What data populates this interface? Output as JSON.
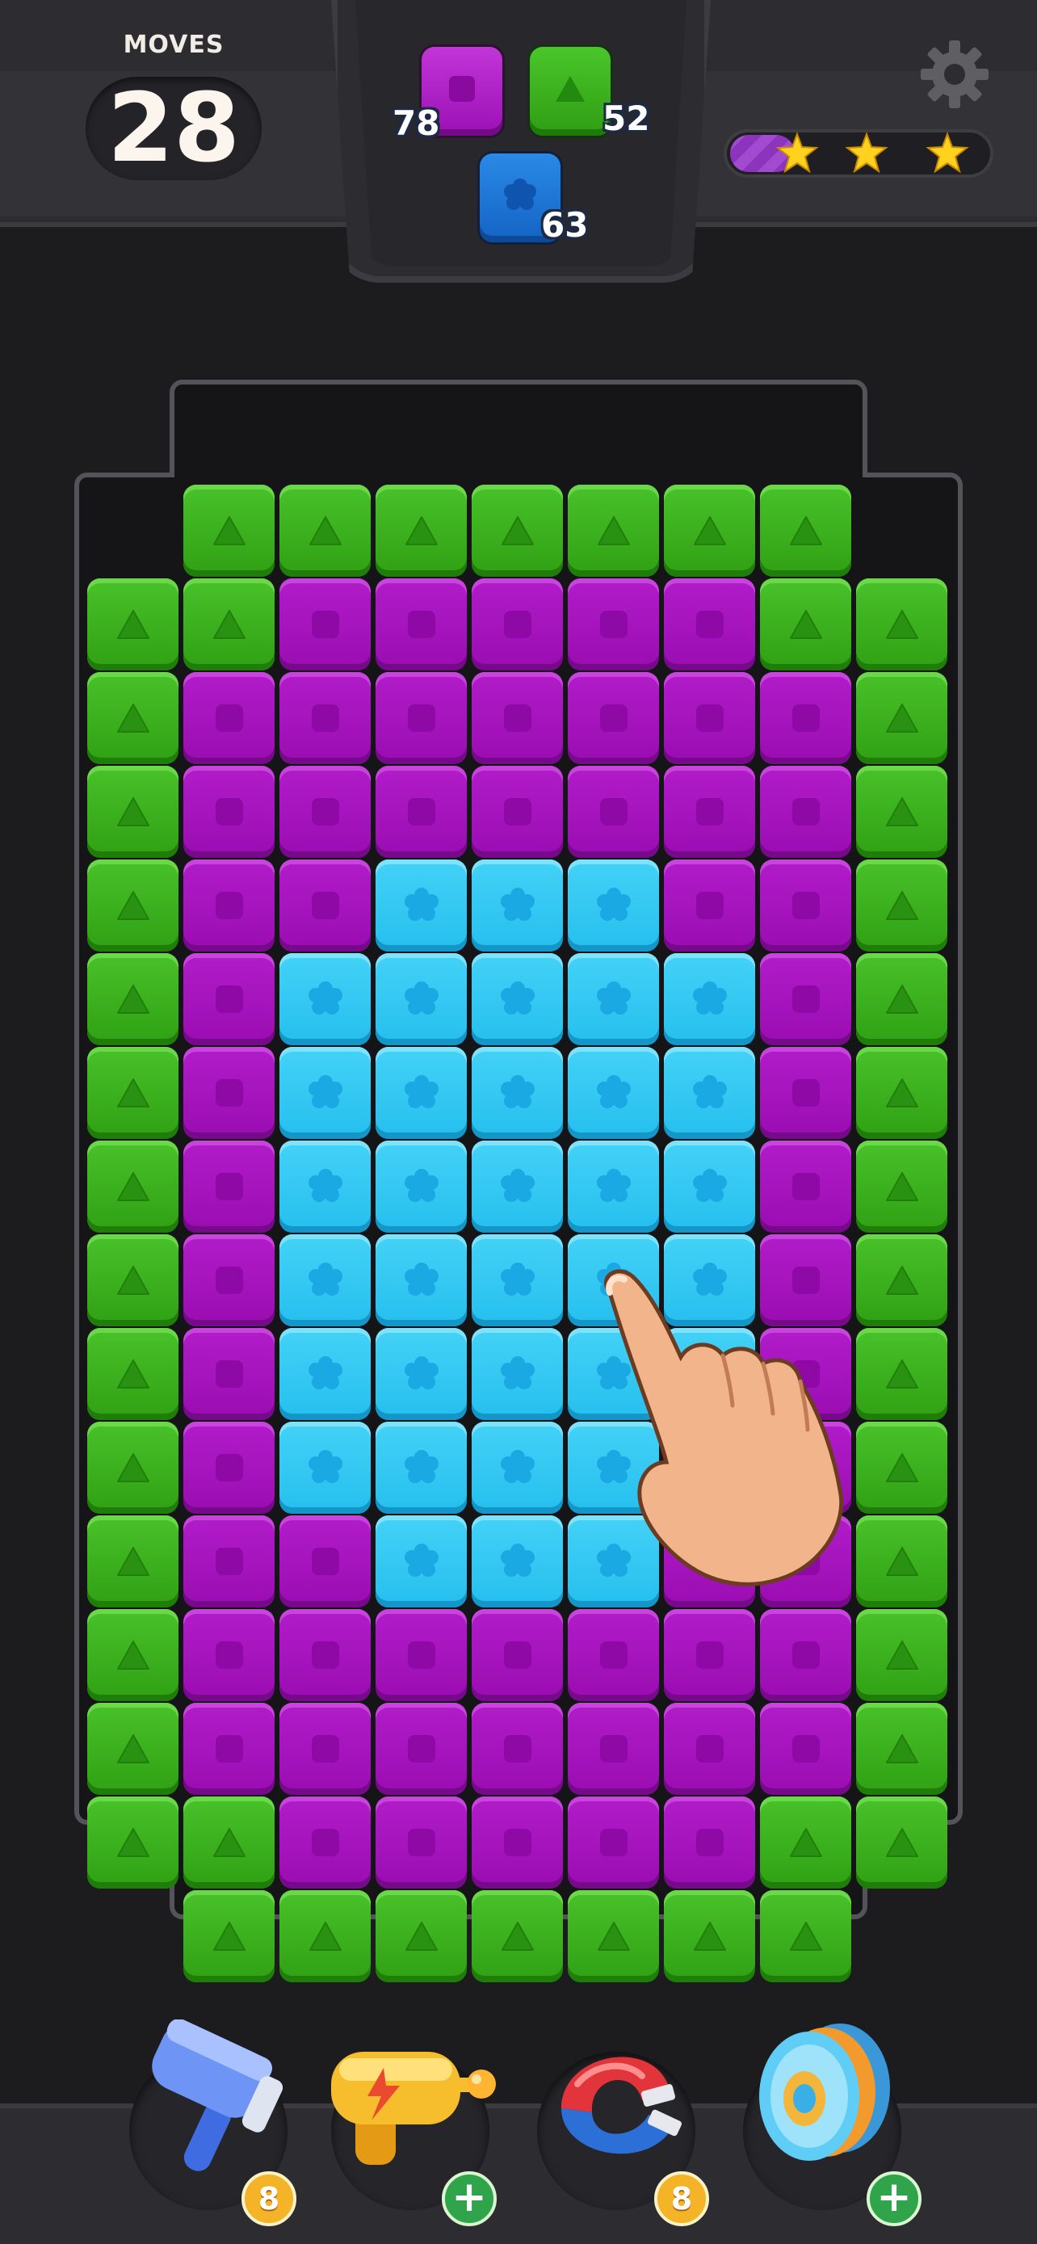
{
  "header": {
    "moves_label": "MOVES",
    "moves_value": "28",
    "settings_icon": "gear-icon"
  },
  "goals": [
    {
      "color": "purple",
      "hex": "#b11cc9",
      "count": "78"
    },
    {
      "color": "green",
      "hex": "#3eb31e",
      "count": "52"
    },
    {
      "color": "blue",
      "hex": "#1676d6",
      "count": "63"
    }
  ],
  "star_progress": {
    "fraction": 0.25,
    "stars": 3
  },
  "board": {
    "columns": 9,
    "rows": 16,
    "legend": {
      "G": "green-triangle",
      "P": "purple-square",
      "C": "cyan-flower",
      ".": "empty"
    },
    "layout": [
      ".GGGGGGG.",
      "GGPPPPPGG",
      "GPPPPPPPG",
      "GPPPPPPPG",
      "GPPCCCPPG",
      "GPCCCCCPG",
      "GPCCCCCPG",
      "GPCCCCCPG",
      "GPCCCCCPG",
      "GPCCCCCPG",
      "GPCCCCPPG",
      "GPPCCCPPG",
      "GPPPPPPPG",
      "GPPPPPPPG",
      "GGPPPPPGG",
      ".GGGGGGG."
    ]
  },
  "tutorial_hint": "tap-hand-icon",
  "boosters": [
    {
      "name": "hammer",
      "icon": "hammer-icon",
      "badge_type": "count",
      "badge": "8"
    },
    {
      "name": "blaster",
      "icon": "blaster-icon",
      "badge_type": "plus",
      "badge": "+"
    },
    {
      "name": "magnet",
      "icon": "magnet-icon",
      "badge_type": "count",
      "badge": "8"
    },
    {
      "name": "disc",
      "icon": "disc-icon",
      "badge_type": "plus",
      "badge": "+"
    }
  ]
}
